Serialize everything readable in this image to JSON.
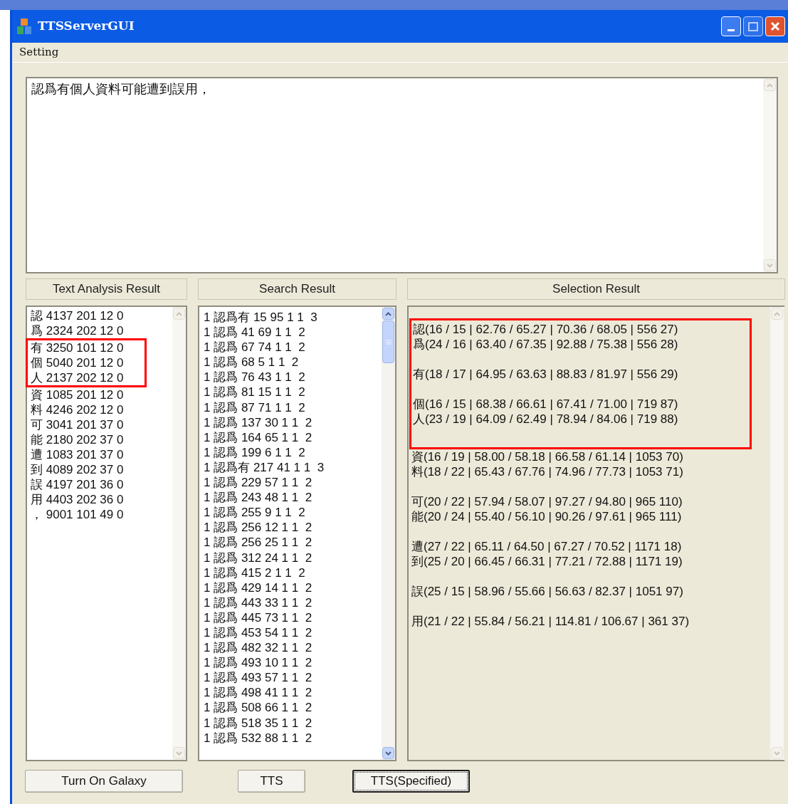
{
  "window": {
    "title": "TTSServerGUI"
  },
  "menu": [
    {
      "label": "Setting"
    }
  ],
  "input_text": "認爲有個人資料可能遭到誤用，",
  "panels": [
    {
      "header": "Text Analysis Result"
    },
    {
      "header": "Search Result"
    },
    {
      "header": "Selection Result"
    }
  ],
  "text_analysis": [
    {
      "text": "認 4137 201 12 0",
      "highlighted": false
    },
    {
      "text": "爲 2324 202 12 0",
      "highlighted": false
    },
    {
      "text": "有 3250 101 12 0",
      "highlighted": true
    },
    {
      "text": "個 5040 201 12 0",
      "highlighted": true
    },
    {
      "text": "人 2137 202 12 0",
      "highlighted": true
    },
    {
      "text": "資 1085 201 12 0",
      "highlighted": false
    },
    {
      "text": "料 4246 202 12 0",
      "highlighted": false
    },
    {
      "text": "可 3041 201 37 0",
      "highlighted": false
    },
    {
      "text": "能 2180 202 37 0",
      "highlighted": false
    },
    {
      "text": "遭 1083 201 37 0",
      "highlighted": false
    },
    {
      "text": "到 4089 202 37 0",
      "highlighted": false
    },
    {
      "text": "誤 4197 201 36 0",
      "highlighted": false
    },
    {
      "text": "用 4403 202 36 0",
      "highlighted": false
    },
    {
      "text": "， 9001 101 49 0",
      "highlighted": false
    }
  ],
  "search_result": [
    "1 認爲有 15 95 1 1  3",
    "1 認爲 41 69 1 1  2",
    "1 認爲 67 74 1 1  2",
    "1 認爲 68 5 1 1  2",
    "1 認爲 76 43 1 1  2",
    "1 認爲 81 15 1 1  2",
    "1 認爲 87 71 1 1  2",
    "1 認爲 137 30 1 1  2",
    "1 認爲 164 65 1 1  2",
    "1 認爲 199 6 1 1  2",
    "1 認爲有 217 41 1 1  3",
    "1 認爲 229 57 1 1  2",
    "1 認爲 243 48 1 1  2",
    "1 認爲 255 9 1 1  2",
    "1 認爲 256 12 1 1  2",
    "1 認爲 256 25 1 1  2",
    "1 認爲 312 24 1 1  2",
    "1 認爲 415 2 1 1  2",
    "1 認爲 429 14 1 1  2",
    "1 認爲 443 33 1 1  2",
    "1 認爲 445 73 1 1  2",
    "1 認爲 453 54 1 1  2",
    "1 認爲 482 32 1 1  2",
    "1 認爲 493 10 1 1  2",
    "1 認爲 493 57 1 1  2",
    "1 認爲 498 41 1 1  2",
    "1 認爲 508 66 1 1  2",
    "1 認爲 518 35 1 1  2",
    "1 認爲 532 88 1 1  2"
  ],
  "selection_result": [
    {
      "highlighted": true,
      "lines": [
        "認(16 / 15 | 62.76 / 65.27 | 70.36 / 68.05 | 556 27)",
        "爲(24 / 16 | 63.40 / 67.35 | 92.88 / 75.38 | 556 28)"
      ]
    },
    {
      "highlighted": true,
      "lines": [
        "有(18 / 17 | 64.95 / 63.63 | 88.83 / 81.97 | 556 29)"
      ]
    },
    {
      "highlighted": true,
      "lines": [
        "個(16 / 15 | 68.38 / 66.61 | 67.41 / 71.00 | 719 87)",
        "人(23 / 19 | 64.09 / 62.49 | 78.94 / 84.06 | 719 88)"
      ]
    },
    {
      "highlighted": false,
      "lines": [
        "資(16 / 19 | 58.00 / 58.18 | 66.58 / 61.14 | 1053 70)",
        "料(18 / 22 | 65.43 / 67.76 | 74.96 / 77.73 | 1053 71)"
      ]
    },
    {
      "highlighted": false,
      "lines": [
        "可(20 / 22 | 57.94 / 58.07 | 97.27 / 94.80 | 965 110)",
        "能(20 / 24 | 55.40 / 56.10 | 90.26 / 97.61 | 965 111)"
      ]
    },
    {
      "highlighted": false,
      "lines": [
        "遭(27 / 22 | 65.11 / 64.50 | 67.27 / 70.52 | 1171 18)",
        "到(25 / 20 | 66.45 / 66.31 | 77.21 / 72.88 | 1171 19)"
      ]
    },
    {
      "highlighted": false,
      "lines": [
        "誤(25 / 15 | 58.96 / 55.66 | 56.63 / 82.37 | 1051 97)"
      ]
    },
    {
      "highlighted": false,
      "lines": [
        "用(21 / 22 | 55.84 / 56.21 | 114.81 / 106.67 | 361 37)"
      ]
    }
  ],
  "buttons": [
    {
      "label": "Turn On Galaxy",
      "focused": false
    },
    {
      "label": "TTS",
      "focused": false
    },
    {
      "label": "TTS(Specified)",
      "focused": true
    }
  ]
}
